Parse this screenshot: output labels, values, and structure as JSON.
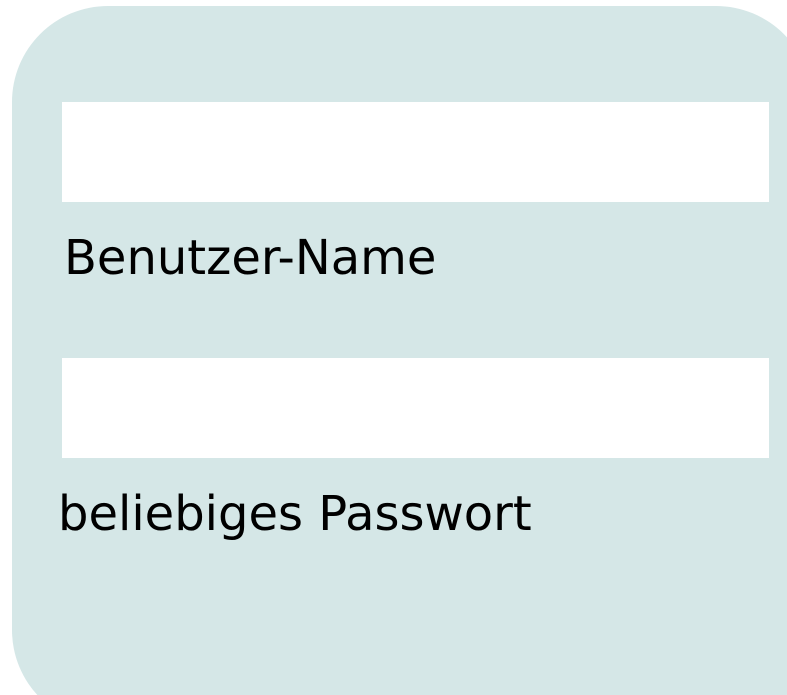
{
  "form": {
    "username": {
      "label": "Benutzer-Name",
      "value": "",
      "placeholder": ""
    },
    "password": {
      "label": "beliebiges Passwort",
      "value": "",
      "placeholder": ""
    }
  },
  "colors": {
    "panel_background": "#d5e7e7",
    "field_background": "#ffffff",
    "text": "#000000"
  }
}
